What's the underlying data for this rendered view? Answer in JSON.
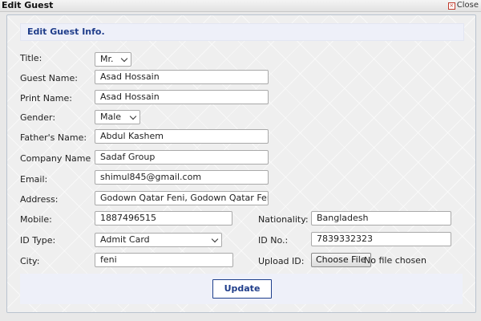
{
  "window": {
    "title": "Edit Guest",
    "close_label": "Close"
  },
  "section": {
    "title": "Edit Guest Info."
  },
  "form": {
    "title": {
      "label": "Title:",
      "value": "Mr."
    },
    "guest_name": {
      "label": "Guest Name:",
      "value": "Asad Hossain"
    },
    "print_name": {
      "label": "Print Name:",
      "value": "Asad Hossain"
    },
    "gender": {
      "label": "Gender:",
      "value": "Male"
    },
    "father_name": {
      "label": "Father's Name:",
      "value": "Abdul Kashem"
    },
    "company_name": {
      "label": "Company Name :",
      "value": "Sadaf Group"
    },
    "email": {
      "label": "Email:",
      "value": "shimul845@gmail.com"
    },
    "address": {
      "label": "Address:",
      "value": "Godown Qatar Feni, Godown Qatar Feni"
    },
    "mobile": {
      "label": "Mobile:",
      "value": "1887496515"
    },
    "nationality": {
      "label": "Nationality:",
      "value": "Bangladesh"
    },
    "id_type": {
      "label": "ID Type:",
      "value": "Admit Card"
    },
    "id_no": {
      "label": "ID No.:",
      "value": "7839332323"
    },
    "city": {
      "label": "City:",
      "value": "feni"
    },
    "upload_id": {
      "label": "Upload ID:",
      "button": "Choose File",
      "status": "No file chosen"
    }
  },
  "actions": {
    "update_label": "Update"
  },
  "colors": {
    "header_text": "#1f3d8a",
    "button_border": "#1e3f8c",
    "section_bg": "#eef0f9"
  }
}
